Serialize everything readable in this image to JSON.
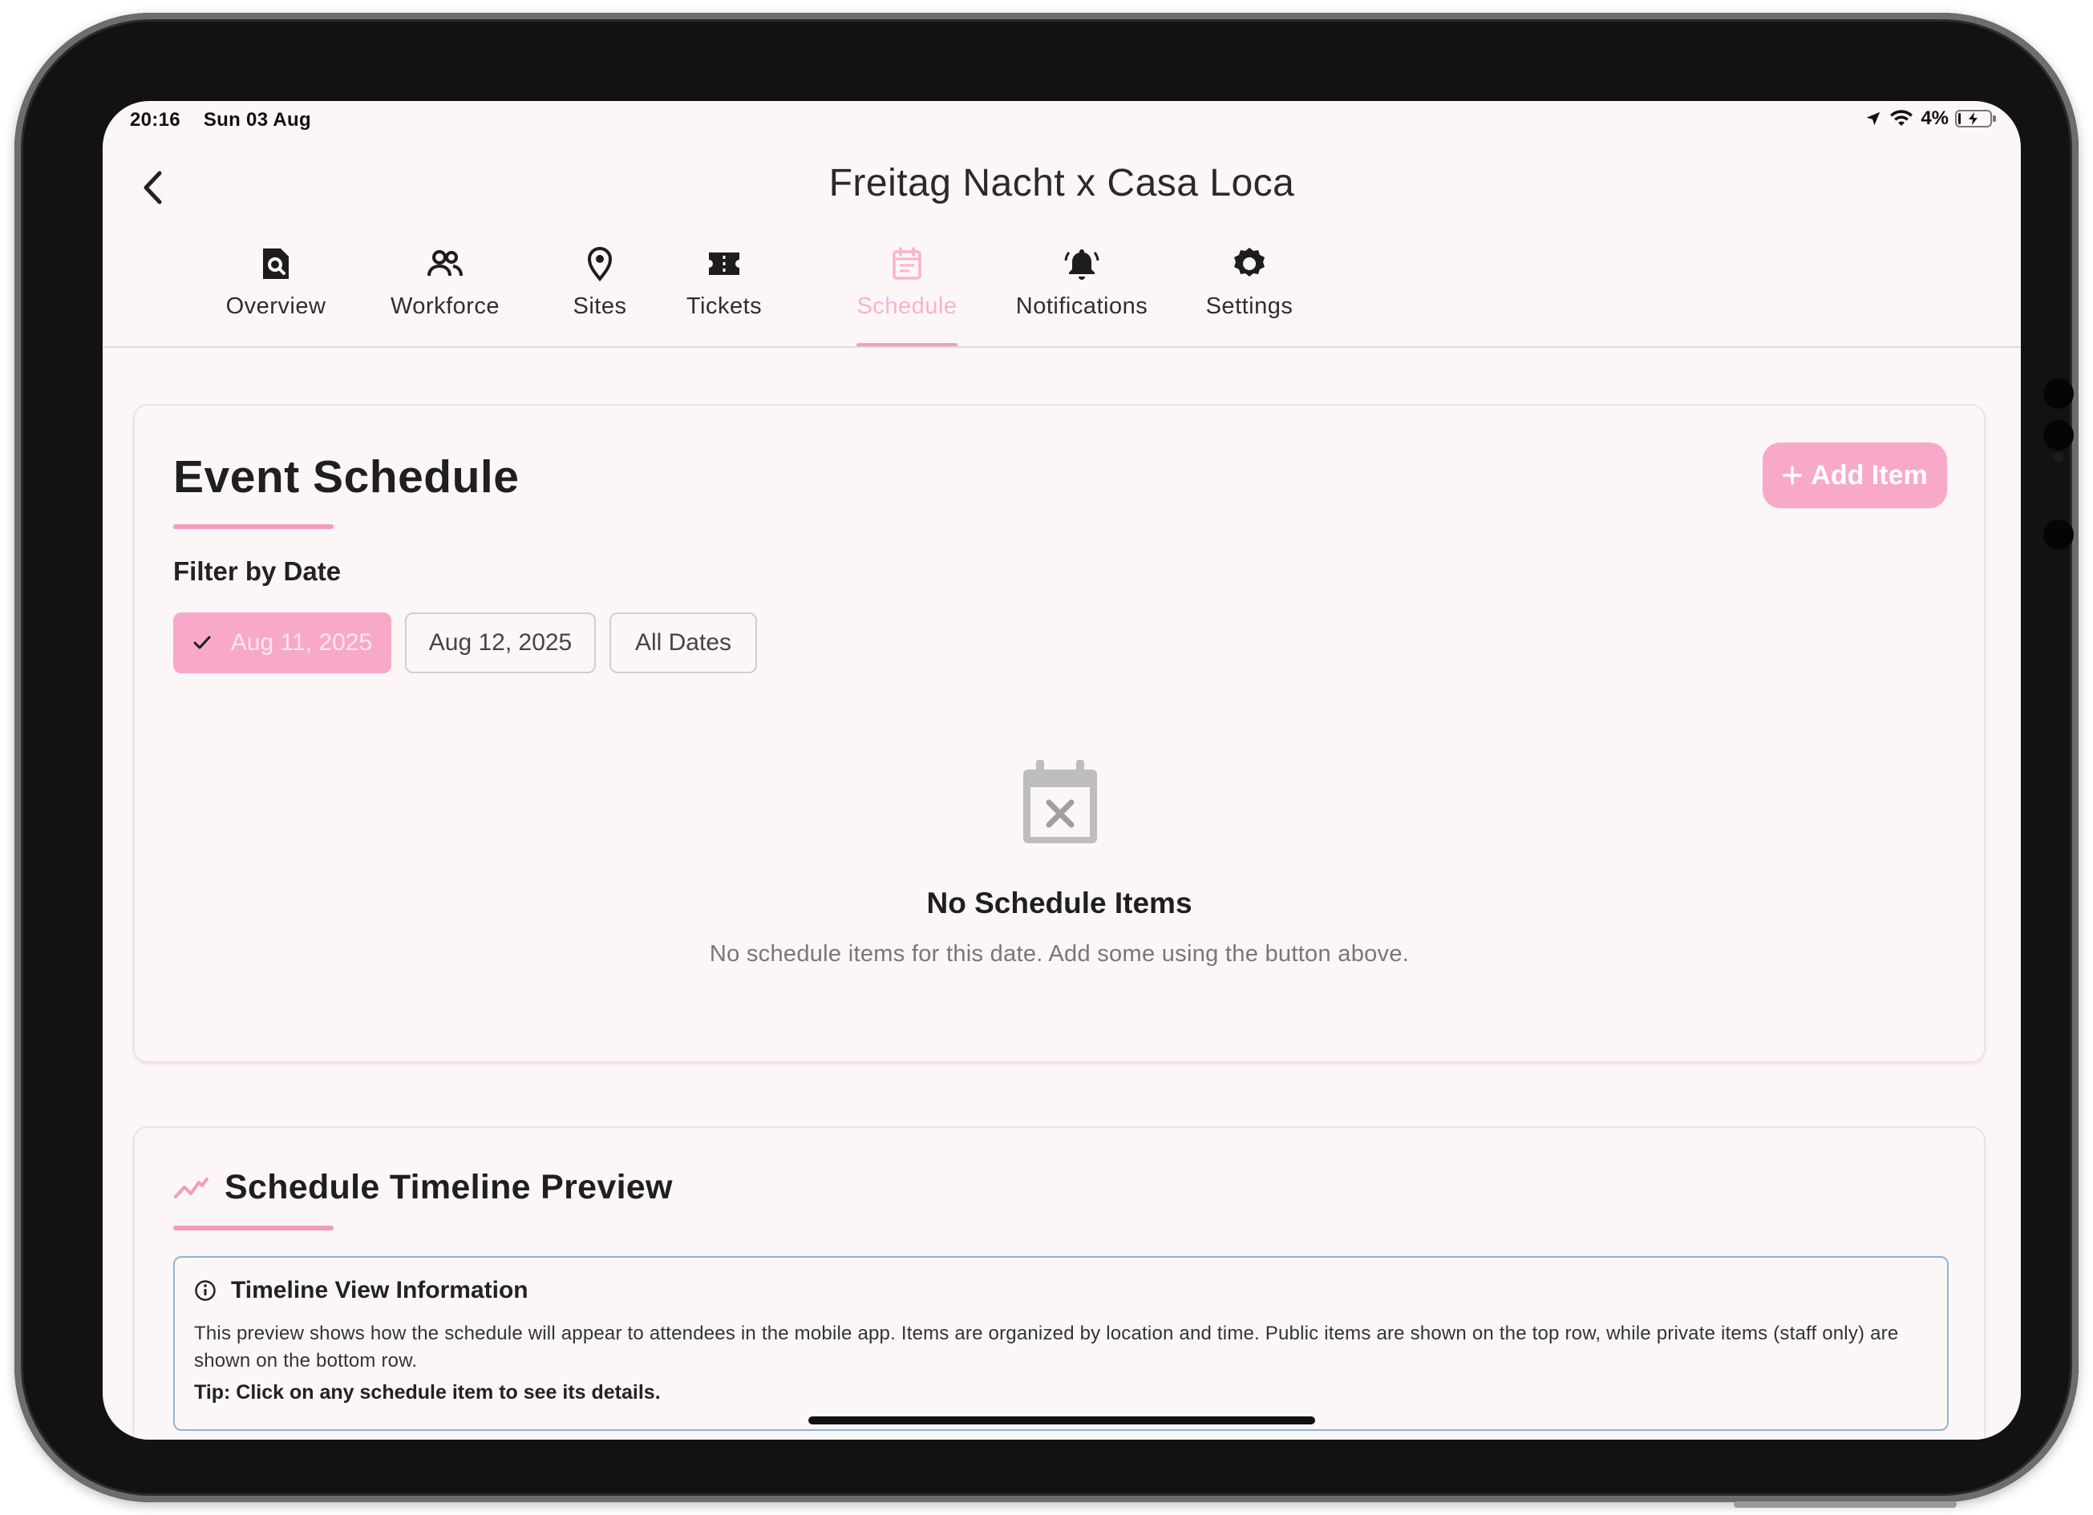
{
  "status_bar": {
    "time": "20:16",
    "date": "Sun 03 Aug",
    "battery": "4%",
    "battery_level": 0.04
  },
  "header": {
    "title": "Freitag Nacht x Casa Loca",
    "back_icon": "chevron-left-icon"
  },
  "tabs": [
    {
      "label": "Overview",
      "icon": "document-search-icon"
    },
    {
      "label": "Workforce",
      "icon": "people-icon"
    },
    {
      "label": "Sites",
      "icon": "location-pin-icon"
    },
    {
      "label": "Tickets",
      "icon": "ticket-icon"
    },
    {
      "label": "Schedule",
      "icon": "calendar-icon",
      "active": true
    },
    {
      "label": "Notifications",
      "icon": "bell-icon"
    },
    {
      "label": "Settings",
      "icon": "gear-icon"
    }
  ],
  "schedule_card": {
    "title": "Event Schedule",
    "add_button": "Add Item",
    "filter_label": "Filter by Date",
    "chips": [
      {
        "label": "Aug 11, 2025",
        "selected": true
      },
      {
        "label": "Aug 12, 2025",
        "selected": false
      },
      {
        "label": "All Dates",
        "selected": false
      }
    ],
    "empty_title": "No Schedule Items",
    "empty_description": "No schedule items for this date. Add some using the button above."
  },
  "timeline_card": {
    "title": "Schedule Timeline Preview",
    "info_title": "Timeline View Information",
    "info_body": "This preview shows how the schedule will appear to attendees in the mobile app. Items are organized by location and time. Public items are shown on the top row, while private items (staff only) are shown on the bottom row.",
    "info_tip": "Tip: Click on any schedule item to see its details."
  },
  "colors": {
    "accent": "#f49bc0",
    "button": "#f8a9c9",
    "info_border": "#8cb6d6",
    "background": "#fdf6f6"
  }
}
